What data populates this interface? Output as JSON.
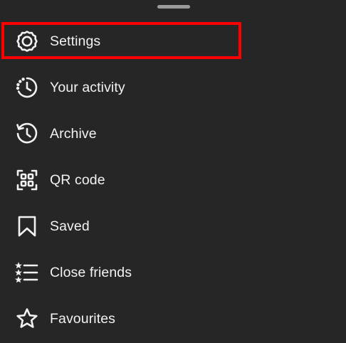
{
  "menu": {
    "items": [
      {
        "label": "Settings",
        "icon": "settings-gear-icon"
      },
      {
        "label": "Your activity",
        "icon": "activity-clock-icon"
      },
      {
        "label": "Archive",
        "icon": "archive-history-icon"
      },
      {
        "label": "QR code",
        "icon": "qr-code-icon"
      },
      {
        "label": "Saved",
        "icon": "bookmark-icon"
      },
      {
        "label": "Close friends",
        "icon": "close-friends-list-icon"
      },
      {
        "label": "Favourites",
        "icon": "star-icon"
      }
    ]
  },
  "colors": {
    "background": "#262626",
    "text": "#f2f2f2",
    "highlight": "#ff0000"
  }
}
